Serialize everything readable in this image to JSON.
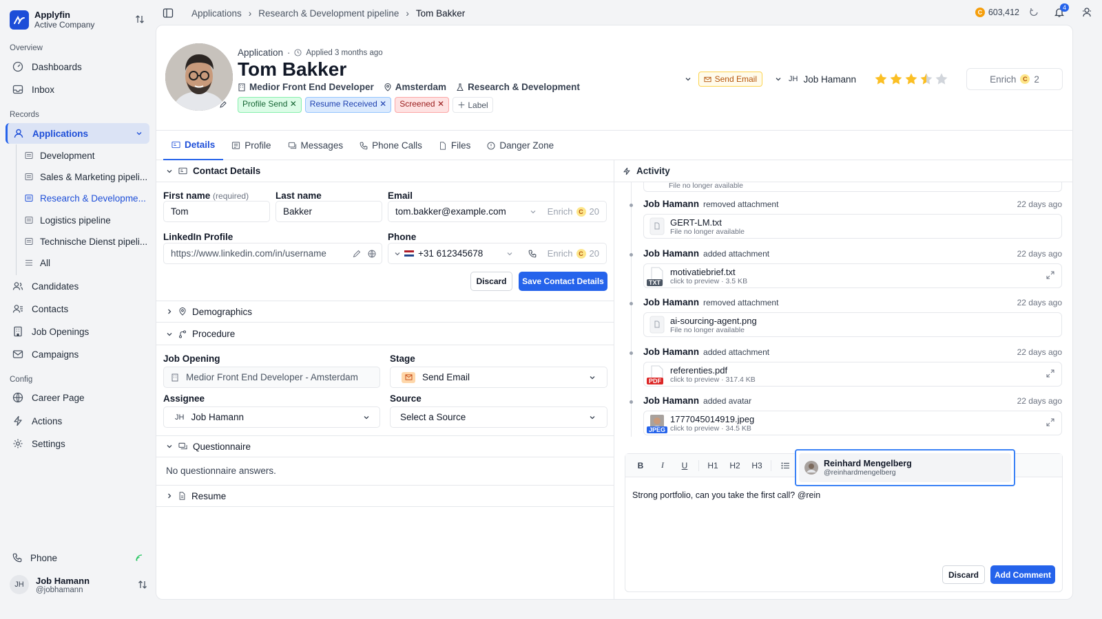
{
  "brand": {
    "name": "Applyfin",
    "company": "Active Company"
  },
  "sidebar": {
    "overview_label": "Overview",
    "records_label": "Records",
    "config_label": "Config",
    "dashboards": "Dashboards",
    "inbox": "Inbox",
    "applications": "Applications",
    "pipelines": [
      "Development",
      "Sales & Marketing pipeli...",
      "Research & Developme...",
      "Logistics pipeline",
      "Technische Dienst pipeli...",
      "All"
    ],
    "candidates": "Candidates",
    "contacts": "Contacts",
    "job_openings": "Job Openings",
    "campaigns": "Campaigns",
    "career_page": "Career Page",
    "actions": "Actions",
    "settings": "Settings",
    "phone": "Phone",
    "user": {
      "initials": "JH",
      "name": "Job Hamann",
      "handle": "@jobhamann"
    }
  },
  "breadcrumb": [
    "Applications",
    "Research & Development pipeline",
    "Tom Bakker"
  ],
  "topbar": {
    "credits": "603,412",
    "notifications": "4"
  },
  "header": {
    "kicker": "Application",
    "applied": "Applied 3 months ago",
    "name": "Tom Bakker",
    "role": "Medior Front End Developer",
    "location": "Amsterdam",
    "department": "Research & Development",
    "tags": [
      "Profile Send",
      "Resume Received",
      "Screened"
    ],
    "add_label": "Label",
    "stage_button": "Send Email",
    "assignee_initials": "JH",
    "assignee": "Job Hamann",
    "rating": 3.5,
    "enrich_label": "Enrich",
    "enrich_cost": "2"
  },
  "tabs": [
    "Details",
    "Profile",
    "Messages",
    "Phone Calls",
    "Files",
    "Danger Zone"
  ],
  "contact": {
    "title": "Contact Details",
    "first_name_label": "First name",
    "required": "(required)",
    "first_name": "Tom",
    "last_name_label": "Last name",
    "last_name": "Bakker",
    "email_label": "Email",
    "email": "tom.bakker@example.com",
    "enrich": "Enrich",
    "enrich_cost": "20",
    "linkedin_label": "LinkedIn Profile",
    "linkedin_placeholder": "https://www.linkedin.com/in/username",
    "phone_label": "Phone",
    "phone_code": "+31",
    "phone": "612345678",
    "discard": "Discard",
    "save": "Save Contact Details"
  },
  "demographics": "Demographics",
  "procedure": {
    "title": "Procedure",
    "job_opening_label": "Job Opening",
    "job_opening": "Medior Front End Developer - Amsterdam",
    "stage_label": "Stage",
    "stage": "Send Email",
    "assignee_label": "Assignee",
    "assignee_initials": "JH",
    "assignee": "Job Hamann",
    "source_label": "Source",
    "source_placeholder": "Select a Source"
  },
  "questionnaire": {
    "title": "Questionnaire",
    "empty": "No questionnaire answers."
  },
  "resume": "Resume",
  "activity": {
    "title": "Activity",
    "top_file_note": "File no longer available",
    "events": [
      {
        "user": "Job Hamann",
        "action": "removed attachment",
        "ago": "22 days ago",
        "file": "GERT-LM.txt",
        "detail": "File no longer available"
      },
      {
        "user": "Job Hamann",
        "action": "added attachment",
        "ago": "22 days ago",
        "file": "motivatiebrief.txt",
        "preview": "click to preview",
        "size": "3.5 KB",
        "type": "TXT"
      },
      {
        "user": "Job Hamann",
        "action": "removed attachment",
        "ago": "22 days ago",
        "file": "ai-sourcing-agent.png",
        "detail": "File no longer available"
      },
      {
        "user": "Job Hamann",
        "action": "added attachment",
        "ago": "22 days ago",
        "file": "referenties.pdf",
        "preview": "click to preview",
        "size": "317.4 KB",
        "type": "PDF"
      },
      {
        "user": "Job Hamann",
        "action": "added avatar",
        "ago": "22 days ago",
        "file": "1777045014919.jpeg",
        "preview": "click to preview",
        "size": "34.5 KB",
        "type": "JPEG"
      }
    ]
  },
  "comment": {
    "text": "Strong portfolio, can you take the first call? @rein",
    "discard": "Discard",
    "submit": "Add Comment",
    "toolbar": [
      "B",
      "I",
      "U",
      "H1",
      "H2",
      "H3"
    ],
    "mention": {
      "name": "Reinhard Mengelberg",
      "handle": "@reinhardmengelberg"
    }
  },
  "colors": {
    "accent": "#2563eb",
    "star": "#fbbf24",
    "coin": "#f59e0b"
  }
}
